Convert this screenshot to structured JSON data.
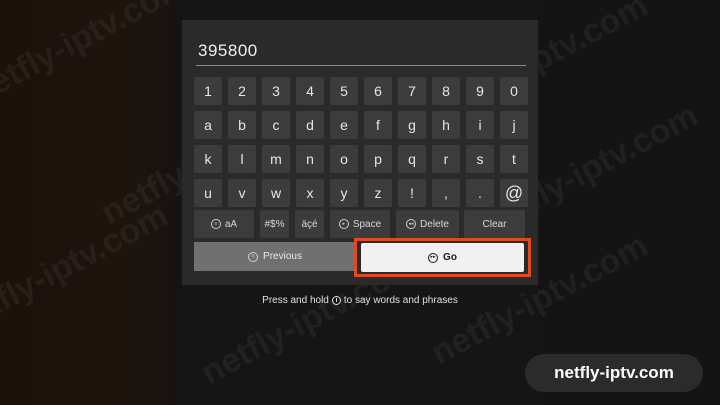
{
  "input": {
    "value": "395800"
  },
  "keyboard": {
    "rows": [
      [
        "1",
        "2",
        "3",
        "4",
        "5",
        "6",
        "7",
        "8",
        "9",
        "0"
      ],
      [
        "a",
        "b",
        "c",
        "d",
        "e",
        "f",
        "g",
        "h",
        "i",
        "j"
      ],
      [
        "k",
        "l",
        "m",
        "n",
        "o",
        "p",
        "q",
        "r",
        "s",
        "t"
      ],
      [
        "u",
        "v",
        "w",
        "x",
        "y",
        "z",
        "!",
        ",",
        ".",
        "@"
      ]
    ],
    "functions": {
      "case_label": "aA",
      "symbols_label": "#$%",
      "accents_label": "äçé",
      "space_label": "Space",
      "delete_label": "Delete",
      "clear_label": "Clear"
    }
  },
  "actions": {
    "previous_label": "Previous",
    "go_label": "Go",
    "highlight_color": "#e04a22"
  },
  "hint": {
    "before": "Press and hold",
    "after": "to say words and phrases"
  },
  "watermark": {
    "site": "netfly-iptv.com",
    "badge": "netfly-iptv.com"
  }
}
